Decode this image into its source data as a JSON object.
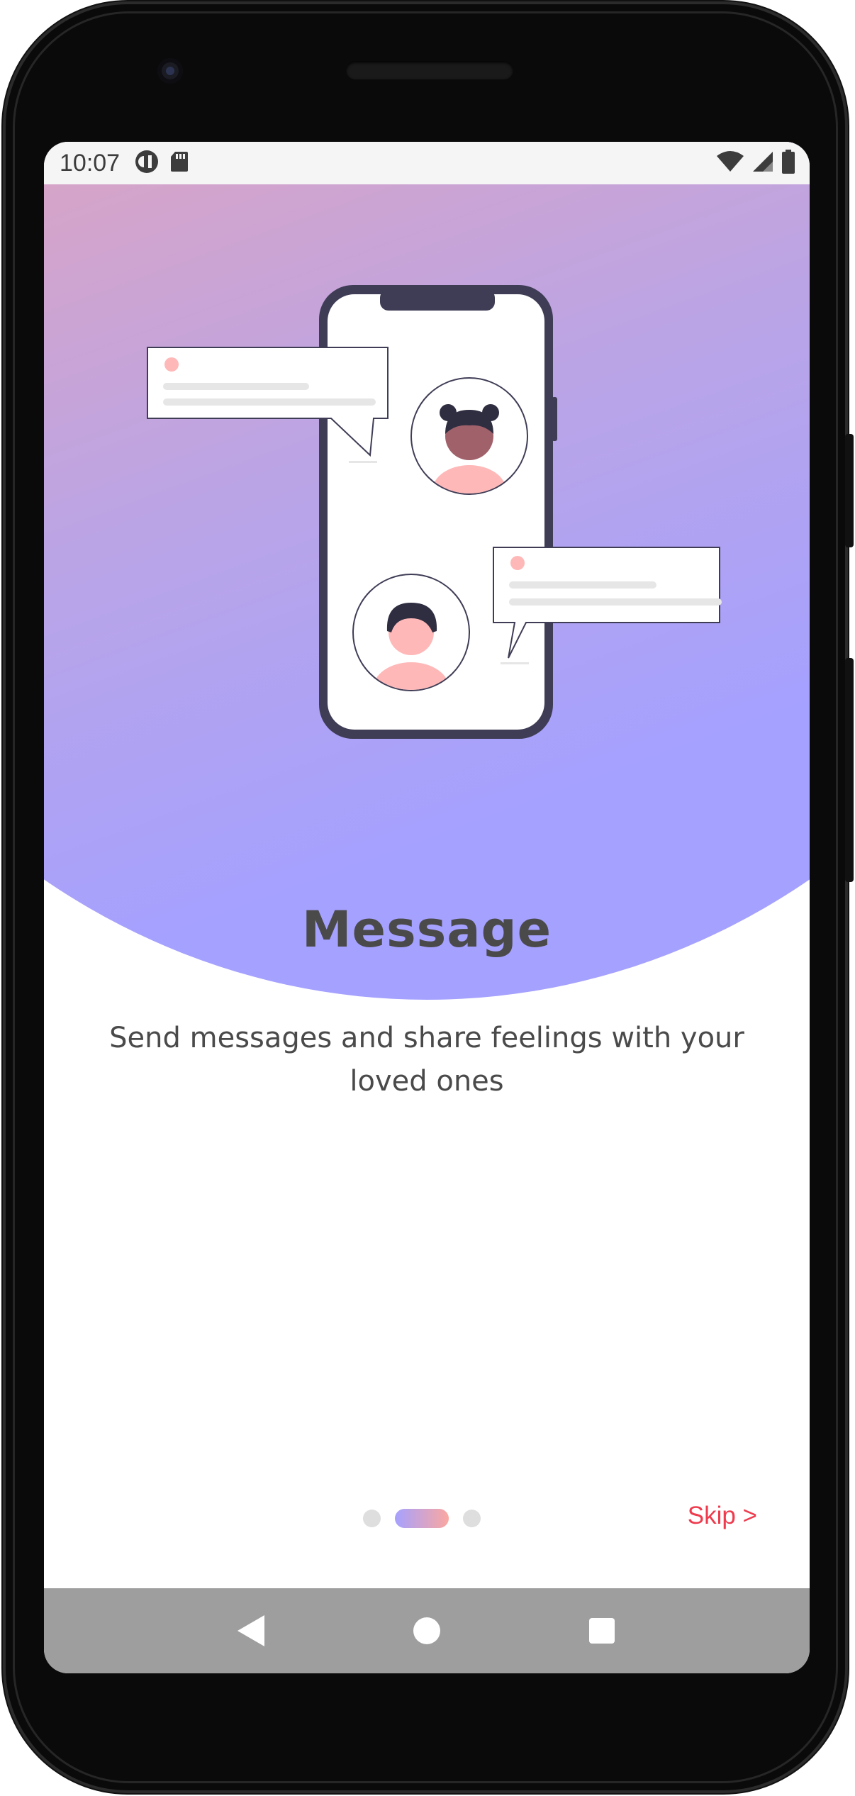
{
  "status_bar": {
    "time": "10:07",
    "left_icons": [
      "assistant-icon",
      "sd-card-icon"
    ],
    "right_icons": [
      "wifi-icon",
      "cellular-signal-icon",
      "battery-icon"
    ]
  },
  "onboarding": {
    "title": "Message",
    "subtitle": "Send messages and share feelings with your loved ones",
    "skip_label": "Skip >",
    "page_indicator": {
      "pages": 3,
      "current": 2
    }
  },
  "navigation_bar": {
    "buttons": [
      "back-icon",
      "home-icon",
      "recents-icon"
    ]
  },
  "colors": {
    "gradient_start": "#fba7a0",
    "gradient_end": "#a5a1ff",
    "title": "#4a4a4a",
    "skip": "#ee3c4e",
    "nav_bar": "#9e9e9e",
    "phone_frame": "#3f3d56"
  }
}
